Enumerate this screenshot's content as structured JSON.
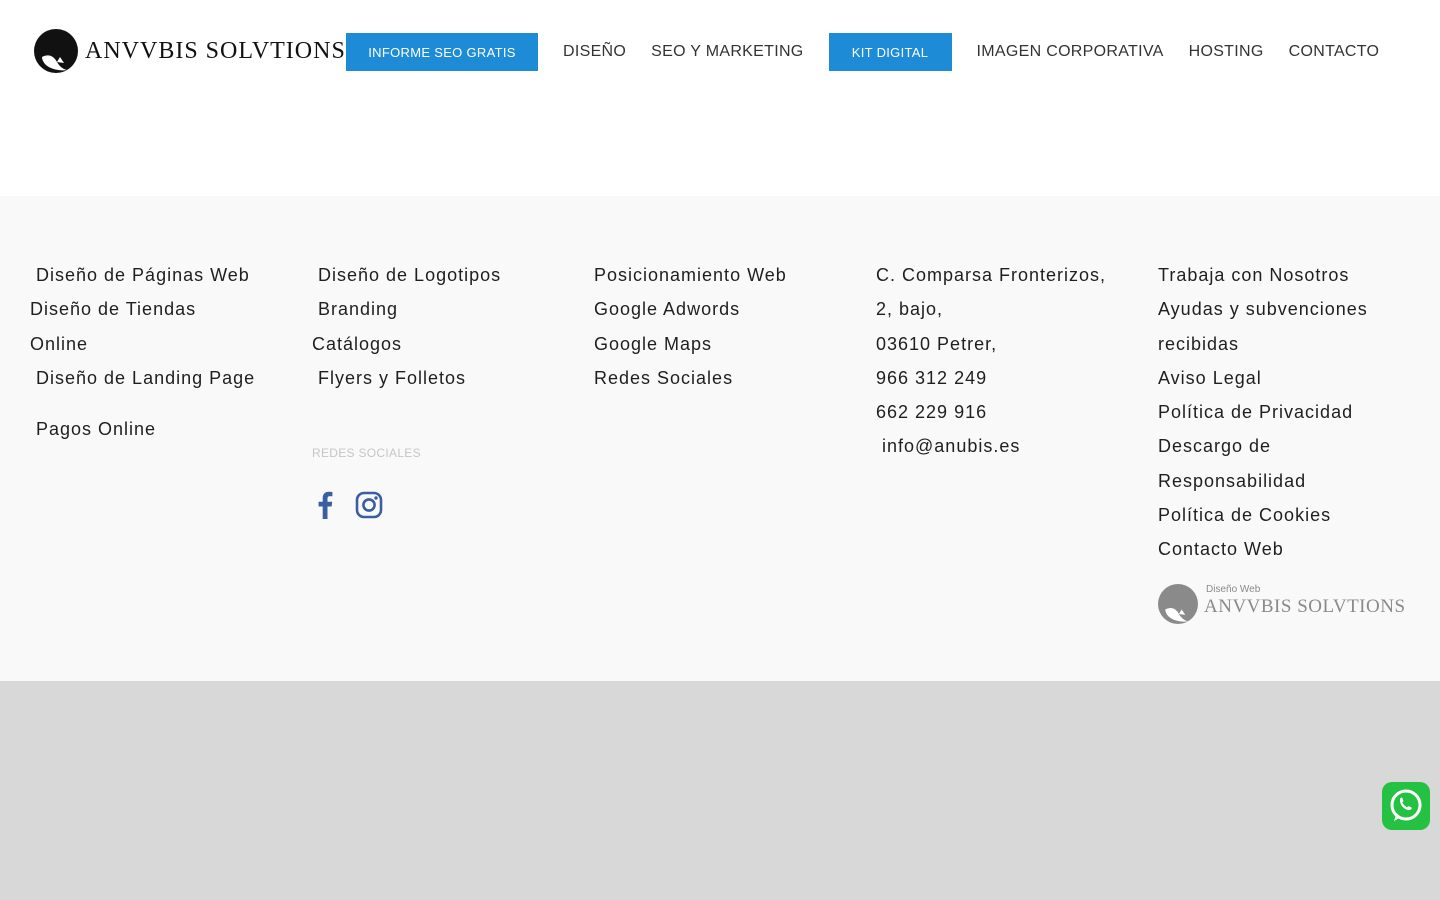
{
  "header": {
    "logo_text": "ANVVBIS SOLVTIONS",
    "nav": {
      "seo_report": "INFORME SEO GRATIS",
      "diseno": "DISEÑO",
      "seo_marketing": "SEO Y MARKETING",
      "kit_digital": "KIT DIGITAL",
      "imagen_corporativa": "IMAGEN CORPORATIVA",
      "hosting": "HOSTING",
      "contacto": "CONTACTO"
    }
  },
  "footer": {
    "col1": {
      "paginas_web": "Diseño de Páginas Web",
      "tiendas_line1": "Diseño de Tiendas",
      "tiendas_line2": "Online",
      "landing_page": "Diseño de Landing Page",
      "pagos_online": "Pagos Online"
    },
    "col2": {
      "logotipos": "Diseño de Logotipos",
      "branding": "Branding",
      "catalogos": "Catálogos",
      "flyers": "Flyers y Folletos",
      "social_label": "REDES SOCIALES"
    },
    "col3": {
      "posicionamiento": "Posicionamiento Web",
      "adwords": "Google Adwords",
      "maps": "Google Maps",
      "redes": "Redes Sociales"
    },
    "col4": {
      "address_line1": "C. Comparsa Fronterizos,",
      "address_line2": "2, bajo,",
      "address_line3": "03610 Petrer,",
      "phone1": "966 312 249",
      "phone2": "662 229 916",
      "email": "info@anubis.es"
    },
    "col5": {
      "trabaja": "Trabaja con Nosotros",
      "ayudas_line1": "Ayudas y subvenciones",
      "ayudas_line2": "recibidas",
      "aviso": "Aviso Legal",
      "privacidad": "Política de Privacidad",
      "descargo_line1": "Descargo de",
      "descargo_line2": "Responsabilidad",
      "cookies": "Política de Cookies",
      "contacto_web": "Contacto Web"
    },
    "badge": {
      "small": "Diseño Web",
      "big": "ANVVBIS SOLVTIONS"
    }
  },
  "icons": {
    "facebook": "facebook-icon",
    "instagram": "instagram-icon",
    "whatsapp": "whatsapp-icon"
  },
  "colors": {
    "accent": "#1e8bd6",
    "social": "#3b5ea0",
    "whatsapp": "#25c142",
    "footer_bg": "#f9f9f9",
    "page_bg": "#d9d8d9"
  }
}
